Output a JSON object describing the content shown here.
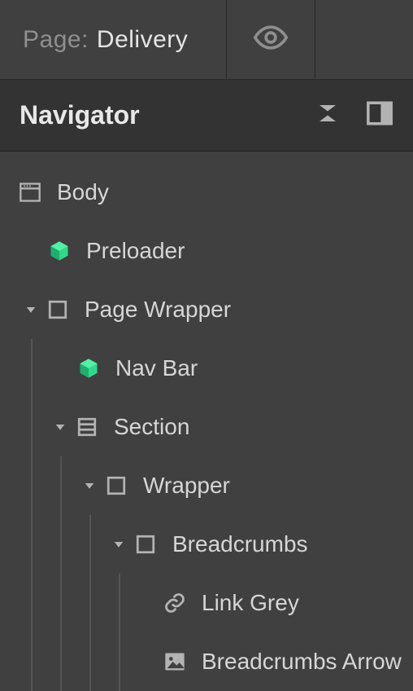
{
  "topbar": {
    "page_prefix": "Page:",
    "page_name": "Delivery"
  },
  "navigator": {
    "title": "Navigator"
  },
  "tree": {
    "body": "Body",
    "preloader": "Preloader",
    "page_wrapper": "Page Wrapper",
    "nav_bar": "Nav Bar",
    "section": "Section",
    "wrapper": "Wrapper",
    "breadcrumbs": "Breadcrumbs",
    "link_grey": "Link Grey",
    "breadcrumbs_arrow": "Breadcrumbs Arrow"
  },
  "colors": {
    "accent_green": "#2fd98b",
    "icon_grey": "#b3b3b3"
  }
}
